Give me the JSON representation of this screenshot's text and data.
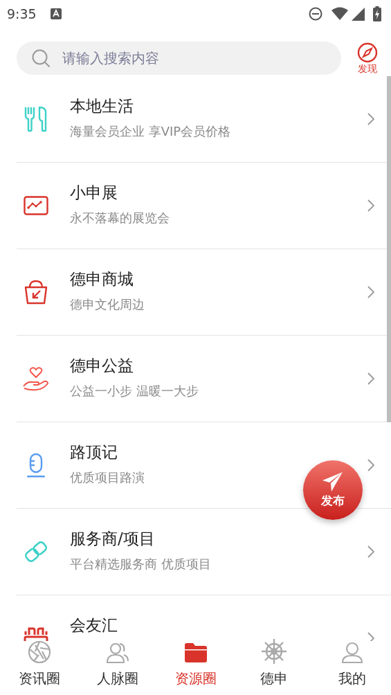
{
  "status_bar": {
    "time": "9:35"
  },
  "search": {
    "placeholder": "请输入搜索内容"
  },
  "discover": {
    "label": "发现"
  },
  "items": [
    {
      "kind": "cutlery",
      "title": "本地生活",
      "subtitle": "海量会员企业 享VIP会员价格"
    },
    {
      "kind": "chart",
      "title": "小申展",
      "subtitle": "永不落幕的展览会"
    },
    {
      "kind": "basket",
      "title": "德申商城",
      "subtitle": "德申文化周边"
    },
    {
      "kind": "charity",
      "title": "德申公益",
      "subtitle": "公益一小步 温暖一大步"
    },
    {
      "kind": "mic",
      "title": "路顶记",
      "subtitle": "优质项目路演"
    },
    {
      "kind": "link",
      "title": "服务商/项目",
      "subtitle": "平台精选服务商 优质项目"
    },
    {
      "kind": "stage",
      "title": "会友汇"
    }
  ],
  "fab": {
    "label": "发布"
  },
  "nav": [
    {
      "kind": "aperture",
      "label": "资讯圈",
      "selected": false
    },
    {
      "kind": "people",
      "label": "人脉圈",
      "selected": false
    },
    {
      "kind": "folder",
      "label": "资源圈",
      "selected": true
    },
    {
      "kind": "helm",
      "label": "德申",
      "selected": false
    },
    {
      "kind": "person",
      "label": "我的",
      "selected": false
    }
  ]
}
